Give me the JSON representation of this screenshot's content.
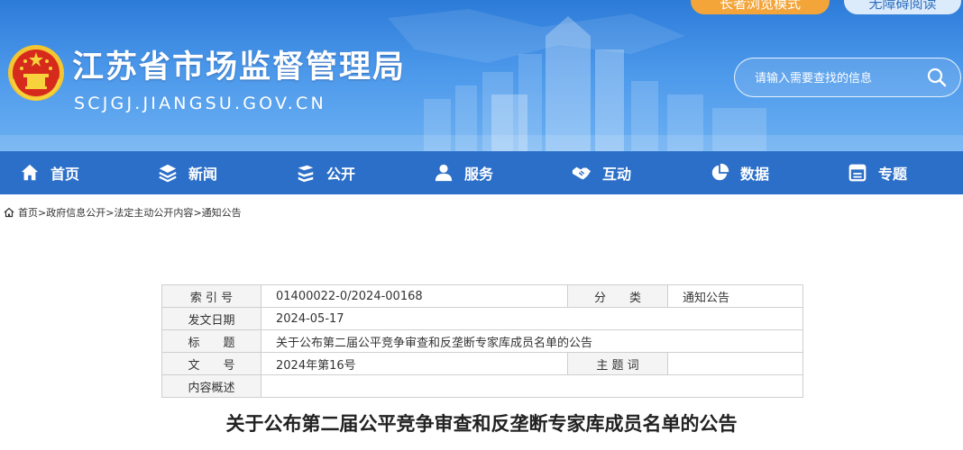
{
  "header": {
    "elder_mode_label": "长者浏览模式",
    "accessible_label": "无障碍阅读",
    "site_title": "江苏省市场监督管理局",
    "site_domain": "SCJGJ.JIANGSU.GOV.CN",
    "search_placeholder": "请输入需要查找的信息"
  },
  "nav": {
    "items": [
      {
        "label": "首页",
        "icon": "home-icon"
      },
      {
        "label": "新闻",
        "icon": "layers-icon"
      },
      {
        "label": "公开",
        "icon": "stack-icon"
      },
      {
        "label": "服务",
        "icon": "user-icon"
      },
      {
        "label": "互动",
        "icon": "handshake-icon"
      },
      {
        "label": "数据",
        "icon": "pie-chart-icon"
      },
      {
        "label": "专题",
        "icon": "window-icon"
      }
    ]
  },
  "breadcrumb": {
    "items": [
      "首页",
      "政府信息公开",
      "法定主动公开内容",
      "通知公告"
    ],
    "separator": ">"
  },
  "meta": {
    "index_label": "索 引 号",
    "index_value": "01400022-0/2024-00168",
    "category_label": "分　　类",
    "category_value": "通知公告",
    "date_label": "发文日期",
    "date_value": "2024-05-17",
    "title_label": "标　　题",
    "title_value": "关于公布第二届公平竞争审查和反垄断专家库成员名单的公告",
    "doc_no_label": "文　　号",
    "doc_no_value": "2024年第16号",
    "keywords_label": "主 题 词",
    "keywords_value": "",
    "summary_label": "内容概述",
    "summary_value": ""
  },
  "article": {
    "title": "关于公布第二届公平竞争审查和反垄断专家库成员名单的公告"
  },
  "colors": {
    "header_blue": "#2c7bd8",
    "nav_blue": "#2c6fc8",
    "elder_pill": "#f3a53a",
    "access_pill": "#dcebfb"
  }
}
